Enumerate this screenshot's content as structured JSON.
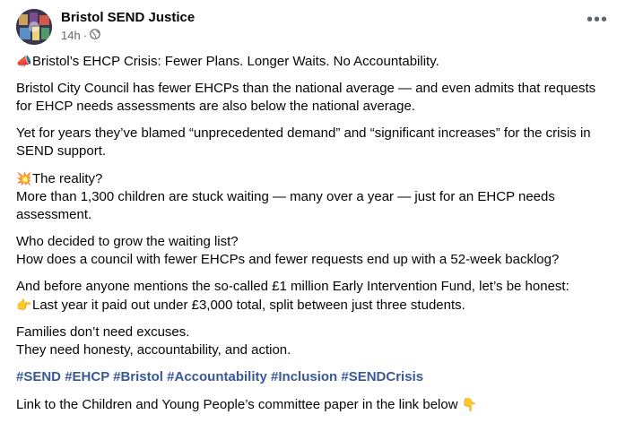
{
  "post": {
    "page_name": "Bristol SEND Justice",
    "time": "14h",
    "separator": "·",
    "globe_icon": "globe-icon",
    "more_icon": "•••"
  },
  "content": {
    "headline_emoji": "📣",
    "headline": "Bristol’s EHCP Crisis: Fewer Plans. Longer Waits. No Accountability.",
    "p1": "Bristol City Council has fewer EHCPs than the national average — and even admits that requests for EHCP needs assessments are also below the national average.",
    "p2": "Yet for years they’ve blamed “unprecedented demand” and “significant increases” for the crisis in SEND support.",
    "reality_emoji": "💥",
    "reality_heading": "The reality?",
    "reality_text": "More than 1,300 children are stuck waiting — many over a year — just for an EHCP needs assessment.",
    "q1": "Who decided to grow the waiting list?",
    "q2": "How does a council with fewer EHCPs and fewer requests end up with a 52-week backlog?",
    "fund_intro": "And before anyone mentions the so-called £1 million Early Intervention Fund, let’s be honest:",
    "point_emoji": "👉",
    "fund_point": "Last year it paid out under £3,000 total, split between just three students.",
    "families1": "Families don’t need excuses.",
    "families2": "They need honesty, accountability, and action.",
    "hashtags": [
      "#SEND",
      "#EHCP",
      "#Bristol",
      "#Accountability",
      "#Inclusion",
      "#SENDCrisis"
    ],
    "link_text": "Link to the Children and Young People’s committee paper in the link below",
    "down_emoji": "👇"
  }
}
